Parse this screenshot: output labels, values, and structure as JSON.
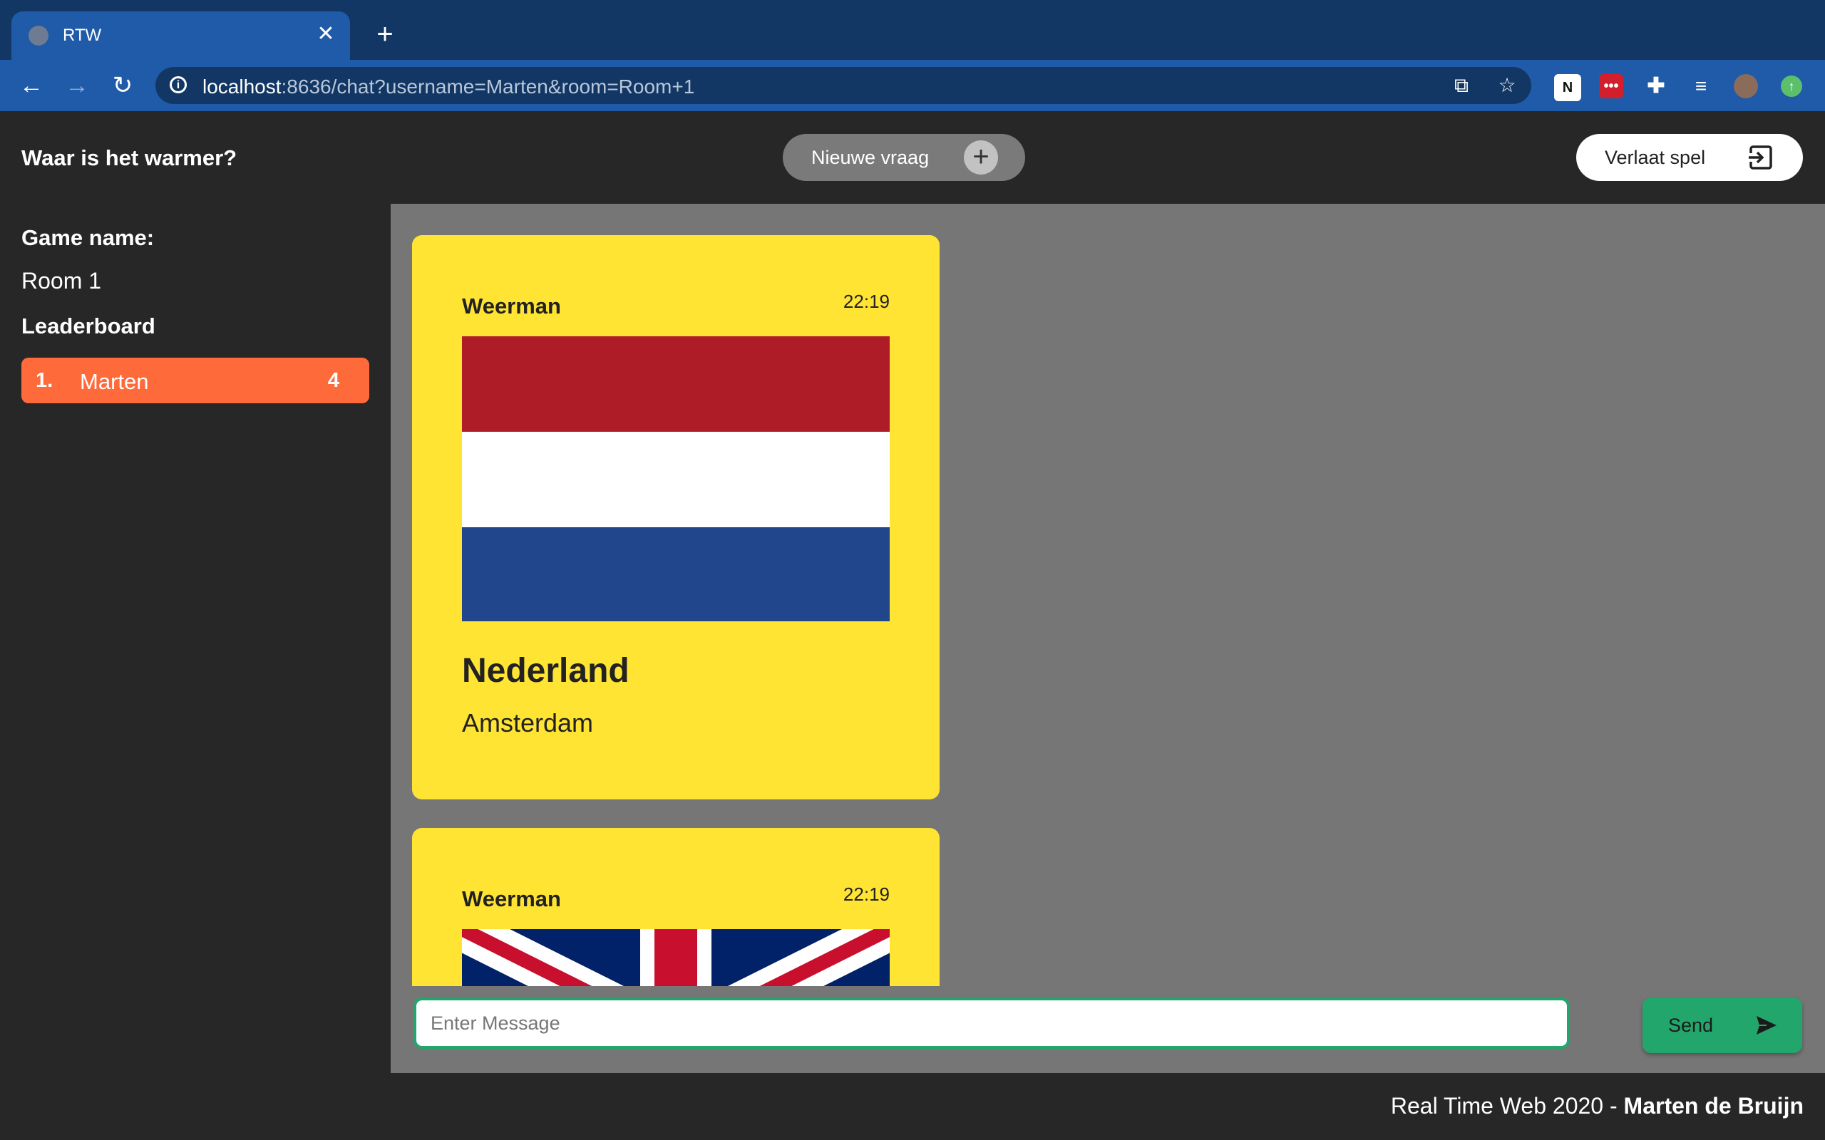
{
  "browser": {
    "tab_title": "RTW",
    "url_host": "localhost",
    "url_path": ":8636/chat?username=Marten&room=Room+1"
  },
  "header": {
    "title": "Waar is het warmer?",
    "new_question_label": "Nieuwe vraag",
    "leave_label": "Verlaat spel"
  },
  "sidebar": {
    "game_name_label": "Game name:",
    "game_name": "Room 1",
    "leaderboard_label": "Leaderboard",
    "leaderboard": [
      {
        "rank": "1.",
        "name": "Marten",
        "score": "4"
      }
    ]
  },
  "messages": [
    {
      "author": "Weerman",
      "time": "22:19",
      "country": "Nederland",
      "city": "Amsterdam",
      "flag": "netherlands-flag",
      "flag_colors": [
        "#ae1c28",
        "#ffffff",
        "#21468b"
      ]
    },
    {
      "author": "Weerman",
      "time": "22:19",
      "flag": "united-kingdom-flag"
    }
  ],
  "compose": {
    "placeholder": "Enter Message",
    "send_label": "Send"
  },
  "footer": {
    "text": "Real Time Web 2020 - ",
    "author": "Marten de Bruijn"
  },
  "colors": {
    "card": "#ffe433",
    "leaderboard_row": "#ff6a3b",
    "send_button": "#22a66b",
    "chat_background": "#767676",
    "app_background": "#272727"
  }
}
